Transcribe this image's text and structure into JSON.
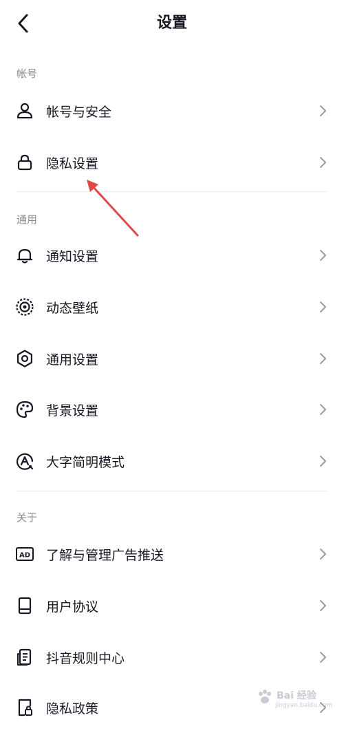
{
  "header": {
    "title": "设置"
  },
  "sections": {
    "account": {
      "label": "帐号",
      "items": [
        {
          "label": "帐号与安全",
          "icon": "user-icon"
        },
        {
          "label": "隐私设置",
          "icon": "lock-icon"
        }
      ]
    },
    "general": {
      "label": "通用",
      "items": [
        {
          "label": "通知设置",
          "icon": "bell-icon"
        },
        {
          "label": "动态壁纸",
          "icon": "live-wallpaper-icon"
        },
        {
          "label": "通用设置",
          "icon": "gear-icon"
        },
        {
          "label": "背景设置",
          "icon": "palette-icon"
        },
        {
          "label": "大字简明模式",
          "icon": "large-font-icon"
        }
      ]
    },
    "about": {
      "label": "关于",
      "items": [
        {
          "label": "了解与管理广告推送",
          "icon": "ad-icon"
        },
        {
          "label": "用户协议",
          "icon": "book-icon"
        },
        {
          "label": "抖音规则中心",
          "icon": "document-icon"
        },
        {
          "label": "隐私政策",
          "icon": "privacy-document-icon"
        }
      ]
    }
  },
  "colors": {
    "text": "#161823",
    "secondary": "#8a8b91",
    "annotation_arrow": "#e04848"
  },
  "watermark": {
    "text": "Bai 经验",
    "sub": "jingyan.baidu.com"
  }
}
